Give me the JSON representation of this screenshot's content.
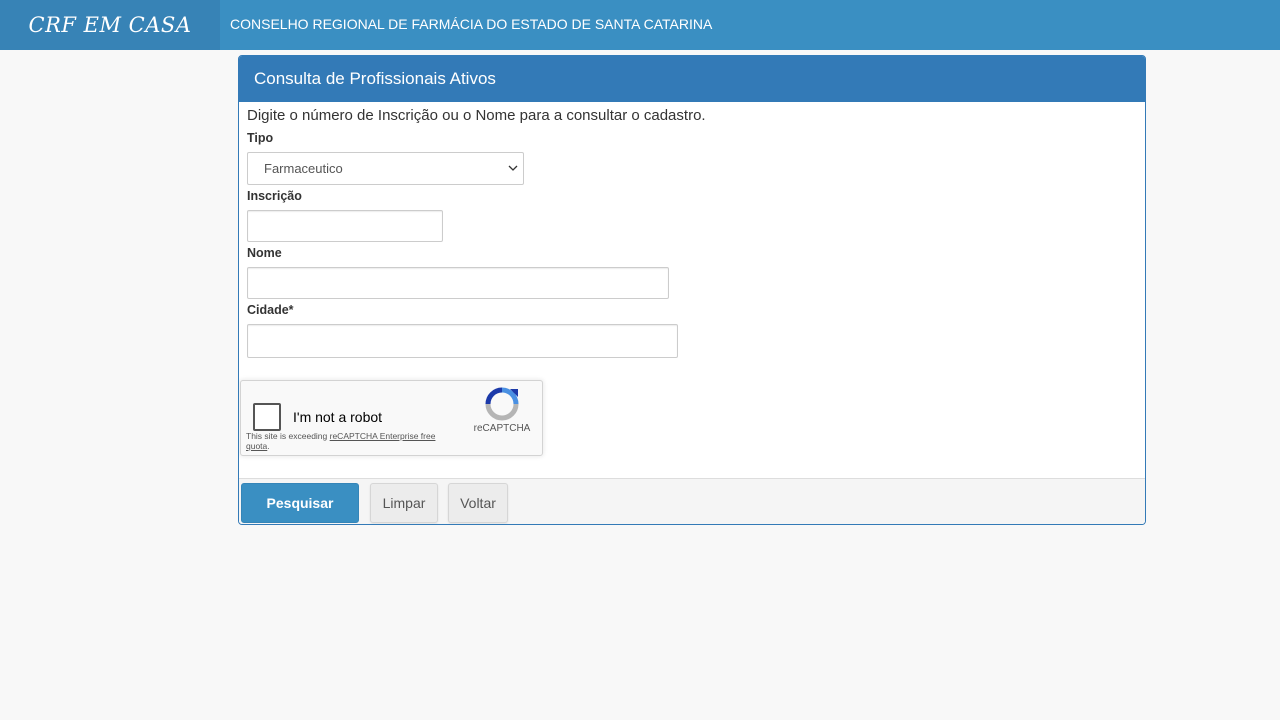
{
  "navbar": {
    "brand": "CRF EM CASA",
    "title": "CONSELHO REGIONAL DE FARMÁCIA DO ESTADO DE SANTA CATARINA"
  },
  "panel": {
    "heading": "Consulta de Profissionais Ativos",
    "instructions": "Digite o número de Inscrição ou o Nome para a consultar o cadastro."
  },
  "form": {
    "tipo_label": "Tipo",
    "tipo_value": "Farmaceutico",
    "inscricao_label": "Inscrição",
    "inscricao_value": "",
    "nome_label": "Nome",
    "nome_value": "",
    "cidade_label": "Cidade*",
    "cidade_value": ""
  },
  "recaptcha": {
    "checkbox_label": "I'm not a robot",
    "note_prefix": "This site is exceeding ",
    "note_link": "reCAPTCHA Enterprise free quota",
    "note_suffix": ".",
    "brand": "reCAPTCHA",
    "logo_icon": "recaptcha-logo-icon"
  },
  "buttons": {
    "search": "Pesquisar",
    "clear": "Limpar",
    "back": "Voltar"
  },
  "colors": {
    "navbar": "#3a8fc2",
    "brand_bg": "#3783b6",
    "panel_heading": "#337ab7",
    "primary_button": "#3a8fc2"
  }
}
